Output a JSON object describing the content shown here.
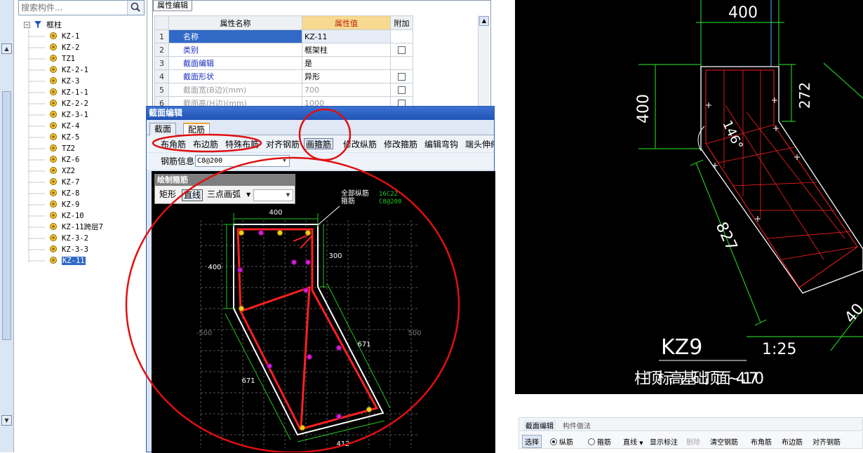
{
  "search": {
    "placeholder": "搜索构件..."
  },
  "tree": {
    "root": "框柱",
    "items": [
      "KZ-1",
      "KZ-2",
      "TZ1",
      "KZ-2-1",
      "KZ-3",
      "KZ-1-1",
      "KZ-2-2",
      "KZ-3-1",
      "KZ-4",
      "KZ-5",
      "TZ2",
      "KZ-6",
      "XZ2",
      "KZ-7",
      "KZ-8",
      "KZ-9",
      "KZ-10",
      "KZ-11跨层7",
      "KZ-3-2",
      "KZ-3-3",
      "KZ-11"
    ],
    "selected": "KZ-11"
  },
  "props": {
    "tab": "属性编辑",
    "headers": {
      "name": "属性名称",
      "value": "属性值",
      "extra": "附加"
    },
    "rows": [
      {
        "num": "1",
        "name": "名称",
        "value": "KZ-11"
      },
      {
        "num": "2",
        "name": "类别",
        "value": "框架柱"
      },
      {
        "num": "3",
        "name": "截面编辑",
        "value": "是"
      },
      {
        "num": "4",
        "name": "截面形状",
        "value": "异形"
      },
      {
        "num": "5",
        "name": "截面宽(B边)(mm)",
        "value": "700"
      },
      {
        "num": "6",
        "name": "截面高(H边)(mm)",
        "value": "1000"
      }
    ]
  },
  "dialog": {
    "title": "截面编辑",
    "tabs": [
      "截面",
      "配筋"
    ],
    "toolbar": [
      "布角筋",
      "布边筋",
      "特殊布筋",
      "对齐钢筋",
      "画箍筋",
      "修改纵筋",
      "修改箍筋",
      "编辑弯钩",
      "端头伸缩"
    ],
    "rebar_info_label": "钢筋信息",
    "rebar_info_value": "C8@200",
    "float_title": "绘制箍筋",
    "float_buttons": [
      "矩形",
      "直线",
      "三点画弧"
    ],
    "legend": [
      {
        "label": "全部纵筋",
        "value": "16C22"
      },
      {
        "label": "箍筋",
        "value": "C8@200"
      }
    ],
    "dims": {
      "top": "400",
      "left": "400",
      "right": "300",
      "diag_right": "671",
      "diag_left": "671",
      "bottom": "412",
      "axis_l": "-500",
      "axis_r": "500"
    }
  },
  "cad": {
    "dims": {
      "top": "400",
      "left": "400",
      "right": "272",
      "diag": "827",
      "angle": "146°",
      "edge": "40"
    },
    "label": "KZ9",
    "scale": "1:25",
    "elevation": "柱顶标高:基础顶面~4.170"
  },
  "bottom": {
    "tabs": [
      "截面编辑",
      "构件做法"
    ],
    "buttons": [
      "选择",
      "纵筋",
      "箍筋",
      "直线",
      "显示标注",
      "删除",
      "清空钢筋",
      "布角筋",
      "布边筋",
      "对齐钢筋"
    ]
  },
  "colors": {
    "accent": "#3169c6",
    "highlight": "#f7d98f",
    "cad_green": "#22c322",
    "cad_red": "#ff2020",
    "annotation": "#e01010"
  }
}
